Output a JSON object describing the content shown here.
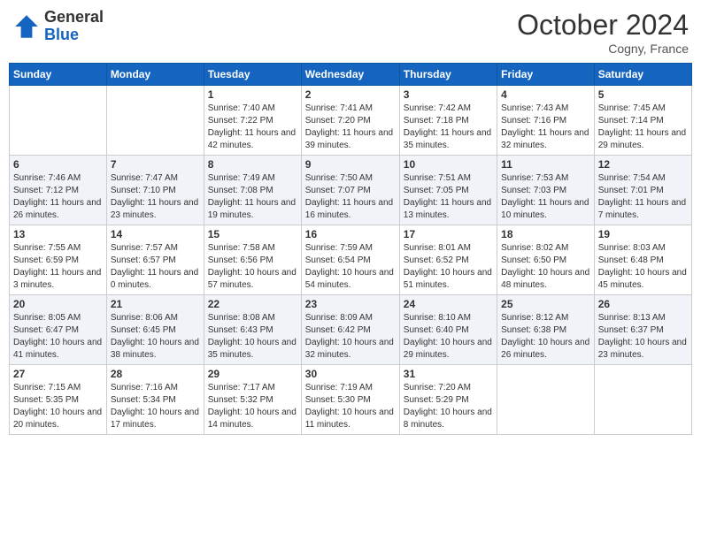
{
  "header": {
    "logo_general": "General",
    "logo_blue": "Blue",
    "month": "October 2024",
    "location": "Cogny, France"
  },
  "weekdays": [
    "Sunday",
    "Monday",
    "Tuesday",
    "Wednesday",
    "Thursday",
    "Friday",
    "Saturday"
  ],
  "weeks": [
    [
      {
        "day": "",
        "sunrise": "",
        "sunset": "",
        "daylight": ""
      },
      {
        "day": "",
        "sunrise": "",
        "sunset": "",
        "daylight": ""
      },
      {
        "day": "1",
        "sunrise": "Sunrise: 7:40 AM",
        "sunset": "Sunset: 7:22 PM",
        "daylight": "Daylight: 11 hours and 42 minutes."
      },
      {
        "day": "2",
        "sunrise": "Sunrise: 7:41 AM",
        "sunset": "Sunset: 7:20 PM",
        "daylight": "Daylight: 11 hours and 39 minutes."
      },
      {
        "day": "3",
        "sunrise": "Sunrise: 7:42 AM",
        "sunset": "Sunset: 7:18 PM",
        "daylight": "Daylight: 11 hours and 35 minutes."
      },
      {
        "day": "4",
        "sunrise": "Sunrise: 7:43 AM",
        "sunset": "Sunset: 7:16 PM",
        "daylight": "Daylight: 11 hours and 32 minutes."
      },
      {
        "day": "5",
        "sunrise": "Sunrise: 7:45 AM",
        "sunset": "Sunset: 7:14 PM",
        "daylight": "Daylight: 11 hours and 29 minutes."
      }
    ],
    [
      {
        "day": "6",
        "sunrise": "Sunrise: 7:46 AM",
        "sunset": "Sunset: 7:12 PM",
        "daylight": "Daylight: 11 hours and 26 minutes."
      },
      {
        "day": "7",
        "sunrise": "Sunrise: 7:47 AM",
        "sunset": "Sunset: 7:10 PM",
        "daylight": "Daylight: 11 hours and 23 minutes."
      },
      {
        "day": "8",
        "sunrise": "Sunrise: 7:49 AM",
        "sunset": "Sunset: 7:08 PM",
        "daylight": "Daylight: 11 hours and 19 minutes."
      },
      {
        "day": "9",
        "sunrise": "Sunrise: 7:50 AM",
        "sunset": "Sunset: 7:07 PM",
        "daylight": "Daylight: 11 hours and 16 minutes."
      },
      {
        "day": "10",
        "sunrise": "Sunrise: 7:51 AM",
        "sunset": "Sunset: 7:05 PM",
        "daylight": "Daylight: 11 hours and 13 minutes."
      },
      {
        "day": "11",
        "sunrise": "Sunrise: 7:53 AM",
        "sunset": "Sunset: 7:03 PM",
        "daylight": "Daylight: 11 hours and 10 minutes."
      },
      {
        "day": "12",
        "sunrise": "Sunrise: 7:54 AM",
        "sunset": "Sunset: 7:01 PM",
        "daylight": "Daylight: 11 hours and 7 minutes."
      }
    ],
    [
      {
        "day": "13",
        "sunrise": "Sunrise: 7:55 AM",
        "sunset": "Sunset: 6:59 PM",
        "daylight": "Daylight: 11 hours and 3 minutes."
      },
      {
        "day": "14",
        "sunrise": "Sunrise: 7:57 AM",
        "sunset": "Sunset: 6:57 PM",
        "daylight": "Daylight: 11 hours and 0 minutes."
      },
      {
        "day": "15",
        "sunrise": "Sunrise: 7:58 AM",
        "sunset": "Sunset: 6:56 PM",
        "daylight": "Daylight: 10 hours and 57 minutes."
      },
      {
        "day": "16",
        "sunrise": "Sunrise: 7:59 AM",
        "sunset": "Sunset: 6:54 PM",
        "daylight": "Daylight: 10 hours and 54 minutes."
      },
      {
        "day": "17",
        "sunrise": "Sunrise: 8:01 AM",
        "sunset": "Sunset: 6:52 PM",
        "daylight": "Daylight: 10 hours and 51 minutes."
      },
      {
        "day": "18",
        "sunrise": "Sunrise: 8:02 AM",
        "sunset": "Sunset: 6:50 PM",
        "daylight": "Daylight: 10 hours and 48 minutes."
      },
      {
        "day": "19",
        "sunrise": "Sunrise: 8:03 AM",
        "sunset": "Sunset: 6:48 PM",
        "daylight": "Daylight: 10 hours and 45 minutes."
      }
    ],
    [
      {
        "day": "20",
        "sunrise": "Sunrise: 8:05 AM",
        "sunset": "Sunset: 6:47 PM",
        "daylight": "Daylight: 10 hours and 41 minutes."
      },
      {
        "day": "21",
        "sunrise": "Sunrise: 8:06 AM",
        "sunset": "Sunset: 6:45 PM",
        "daylight": "Daylight: 10 hours and 38 minutes."
      },
      {
        "day": "22",
        "sunrise": "Sunrise: 8:08 AM",
        "sunset": "Sunset: 6:43 PM",
        "daylight": "Daylight: 10 hours and 35 minutes."
      },
      {
        "day": "23",
        "sunrise": "Sunrise: 8:09 AM",
        "sunset": "Sunset: 6:42 PM",
        "daylight": "Daylight: 10 hours and 32 minutes."
      },
      {
        "day": "24",
        "sunrise": "Sunrise: 8:10 AM",
        "sunset": "Sunset: 6:40 PM",
        "daylight": "Daylight: 10 hours and 29 minutes."
      },
      {
        "day": "25",
        "sunrise": "Sunrise: 8:12 AM",
        "sunset": "Sunset: 6:38 PM",
        "daylight": "Daylight: 10 hours and 26 minutes."
      },
      {
        "day": "26",
        "sunrise": "Sunrise: 8:13 AM",
        "sunset": "Sunset: 6:37 PM",
        "daylight": "Daylight: 10 hours and 23 minutes."
      }
    ],
    [
      {
        "day": "27",
        "sunrise": "Sunrise: 7:15 AM",
        "sunset": "Sunset: 5:35 PM",
        "daylight": "Daylight: 10 hours and 20 minutes."
      },
      {
        "day": "28",
        "sunrise": "Sunrise: 7:16 AM",
        "sunset": "Sunset: 5:34 PM",
        "daylight": "Daylight: 10 hours and 17 minutes."
      },
      {
        "day": "29",
        "sunrise": "Sunrise: 7:17 AM",
        "sunset": "Sunset: 5:32 PM",
        "daylight": "Daylight: 10 hours and 14 minutes."
      },
      {
        "day": "30",
        "sunrise": "Sunrise: 7:19 AM",
        "sunset": "Sunset: 5:30 PM",
        "daylight": "Daylight: 10 hours and 11 minutes."
      },
      {
        "day": "31",
        "sunrise": "Sunrise: 7:20 AM",
        "sunset": "Sunset: 5:29 PM",
        "daylight": "Daylight: 10 hours and 8 minutes."
      },
      {
        "day": "",
        "sunrise": "",
        "sunset": "",
        "daylight": ""
      },
      {
        "day": "",
        "sunrise": "",
        "sunset": "",
        "daylight": ""
      }
    ]
  ]
}
